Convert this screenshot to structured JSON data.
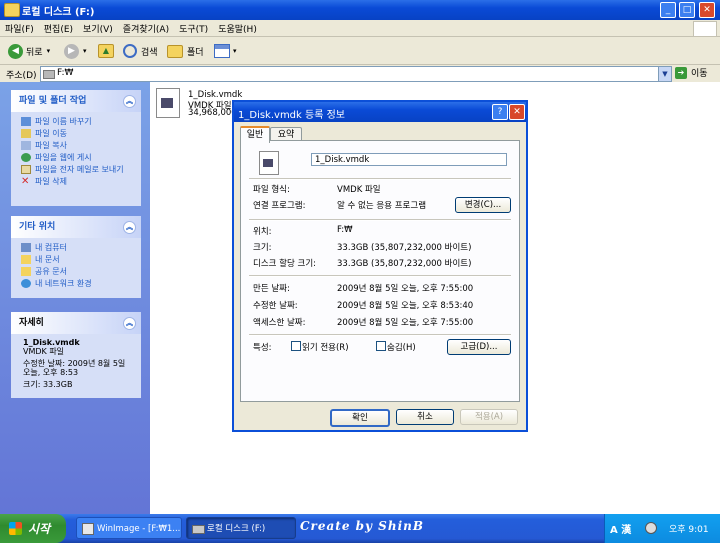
{
  "window": {
    "title": "로컬 디스크 (F:)"
  },
  "menu": [
    "파일(F)",
    "편집(E)",
    "보기(V)",
    "즐겨찾기(A)",
    "도구(T)",
    "도움말(H)"
  ],
  "toolbar": {
    "back": "뒤로",
    "search": "검색",
    "folders": "폴더"
  },
  "address": {
    "label": "주소(D)",
    "value": "F:₩",
    "go": "이동"
  },
  "tasks_panel": {
    "title": "파일 및 폴더 작업",
    "items": [
      "파일 이름 바꾸기",
      "파일 이동",
      "파일 복사",
      "파일을 웹에 게시",
      "파일을 전자 메일로 보내기",
      "파일 삭제"
    ]
  },
  "places_panel": {
    "title": "기타 위치",
    "items": [
      "내 컴퓨터",
      "내 문서",
      "공유 문서",
      "내 네트워크 환경"
    ]
  },
  "details_panel": {
    "title": "자세히",
    "name": "1_Disk.vmdk",
    "type": "VMDK 파일",
    "modified": "수정한 날짜: 2009년 8월 5일 오늘, 오후 8:53",
    "size": "크기: 33.3GB"
  },
  "file_item": {
    "name": "1_Disk.vmdk",
    "type": "VMDK 파일",
    "size": "34,968,000KB"
  },
  "dialog": {
    "title": "1_Disk.vmdk 등록 정보",
    "tabs": [
      "일반",
      "요약"
    ],
    "filename": "1_Disk.vmdk",
    "rows": {
      "type_label": "파일 형식:",
      "type_value": "VMDK 파일",
      "opens_label": "연결 프로그램:",
      "opens_value": "알 수 없는 응용 프로그램",
      "change_button": "변경(C)...",
      "location_label": "위치:",
      "location_value": "F:₩",
      "size_label": "크기:",
      "size_value": "33.3GB (35,807,232,000 바이트)",
      "disk_label": "디스크 할당 크기:",
      "disk_value": "33.3GB (35,807,232,000 바이트)",
      "created_label": "만든 날짜:",
      "created_value": "2009년 8월 5일 오늘, 오후 7:55:00",
      "modified_label": "수정한 날짜:",
      "modified_value": "2009년 8월 5일 오늘, 오후 8:53:40",
      "accessed_label": "액세스한 날짜:",
      "accessed_value": "2009년 8월 5일 오늘, 오후 7:55:00",
      "attr_label": "특성:",
      "readonly": "읽기 전용(R)",
      "hidden": "숨김(H)",
      "advanced": "고급(D)..."
    },
    "buttons": {
      "ok": "확인",
      "cancel": "취소",
      "apply": "적용(A)"
    }
  },
  "taskbar": {
    "start": "시작",
    "tasks": [
      "WinImage - [F:₩1...",
      "로컬 디스크 (F:)"
    ],
    "watermark": "Create by ShinB",
    "ime": "A 漢",
    "clock": "오후 9:01"
  },
  "colors": {
    "xp_blue": "#0a4ad6",
    "start_green": "#3a9a3a",
    "panel_bg": "#d6dff7",
    "link": "#215dc6"
  }
}
